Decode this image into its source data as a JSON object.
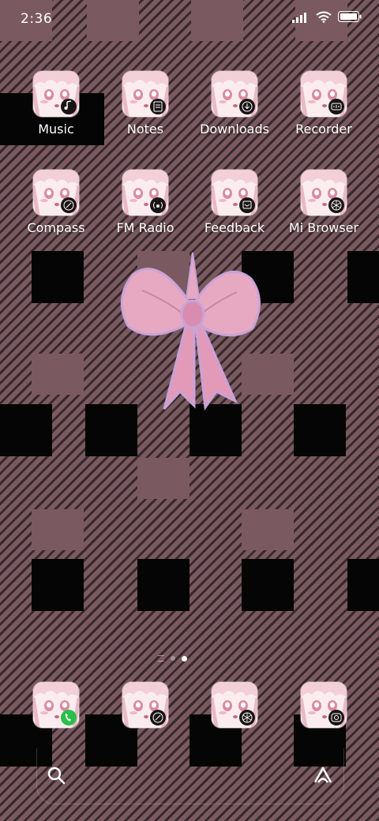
{
  "status_bar": {
    "time": "2:36",
    "icons": [
      "signal-icon",
      "wifi-icon",
      "battery-icon"
    ]
  },
  "apps": [
    {
      "label": "Music",
      "badge_icon": "music-note-icon"
    },
    {
      "label": "Notes",
      "badge_icon": "note-icon"
    },
    {
      "label": "Downloads",
      "badge_icon": "download-icon"
    },
    {
      "label": "Recorder",
      "badge_icon": "recorder-icon"
    },
    {
      "label": "Compass",
      "badge_icon": "compass-icon"
    },
    {
      "label": "FM Radio",
      "badge_icon": "radio-icon"
    },
    {
      "label": "Feedback",
      "badge_icon": "feedback-icon"
    },
    {
      "label": "Mi Browser",
      "badge_icon": "browser-icon"
    }
  ],
  "dock": [
    {
      "name": "phone",
      "badge_icon": "phone-icon"
    },
    {
      "name": "compass",
      "badge_icon": "compass-icon"
    },
    {
      "name": "browser",
      "badge_icon": "globe-icon"
    },
    {
      "name": "camera",
      "badge_icon": "camera-icon"
    }
  ],
  "page_indicator": {
    "pages": 2,
    "current": 2
  },
  "search_bar": {
    "left_icon": "search-icon",
    "right_icon": "assistant-icon"
  },
  "colors": {
    "plaid_light": "#7a5a60",
    "plaid_dark": "#050505",
    "icon_bg": "#fbecef",
    "bow_pink": "#e7a9c2",
    "phone_badge": "#27c04a"
  }
}
